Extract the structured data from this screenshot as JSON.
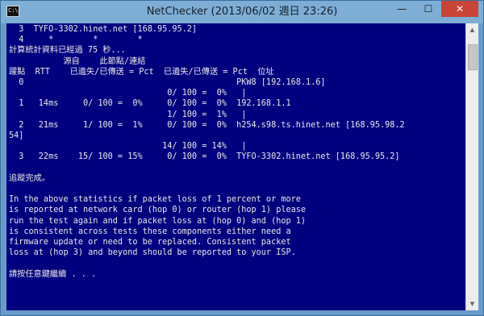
{
  "window": {
    "title": "NetChecker (2013/06/02 週日 23:26)",
    "icon_text": "C:\\"
  },
  "controls": {
    "minimize": "—",
    "maximize": "☐",
    "close": "✕"
  },
  "scrollbar": {
    "up_arrow": "▲",
    "down_arrow": "▼"
  },
  "console": {
    "lines": [
      "  3  TYFO-3302.hinet.net [168.95.95.2]",
      "  4     *        *        *",
      "計算統計資料已經過 75 秒...",
      "           源自    此節點/連結",
      "躍點  RTT    已遺失/已傳送 = Pct  已遺失/已傳送 = Pct  位址",
      "  0                                           PKW8 [192.168.1.6]",
      "                                0/ 100 =  0%   |",
      "  1   14ms     0/ 100 =  0%     0/ 100 =  0%  192.168.1.1",
      "                                1/ 100 =  1%   |",
      "  2   21ms     1/ 100 =  1%     0/ 100 =  0%  h254.s98.ts.hinet.net [168.95.98.2",
      "54]",
      "                               14/ 100 = 14%   |",
      "  3   22ms    15/ 100 = 15%     0/ 100 =  0%  TYFO-3302.hinet.net [168.95.95.2]",
      "",
      "追蹤完成。",
      "",
      "In the above statistics if packet loss of 1 percent or more",
      "is reported at network card (hop 0) or router (hop 1) please",
      "run the test again and if packet loss at (hop 0) and (hop 1)",
      "is consistent across tests these components either need a",
      "firmware update or need to be replaced. Consistent packet",
      "loss at (hop 3) and beyond should be reported to your ISP.",
      "",
      "請按任意鍵繼續 . . ."
    ]
  }
}
